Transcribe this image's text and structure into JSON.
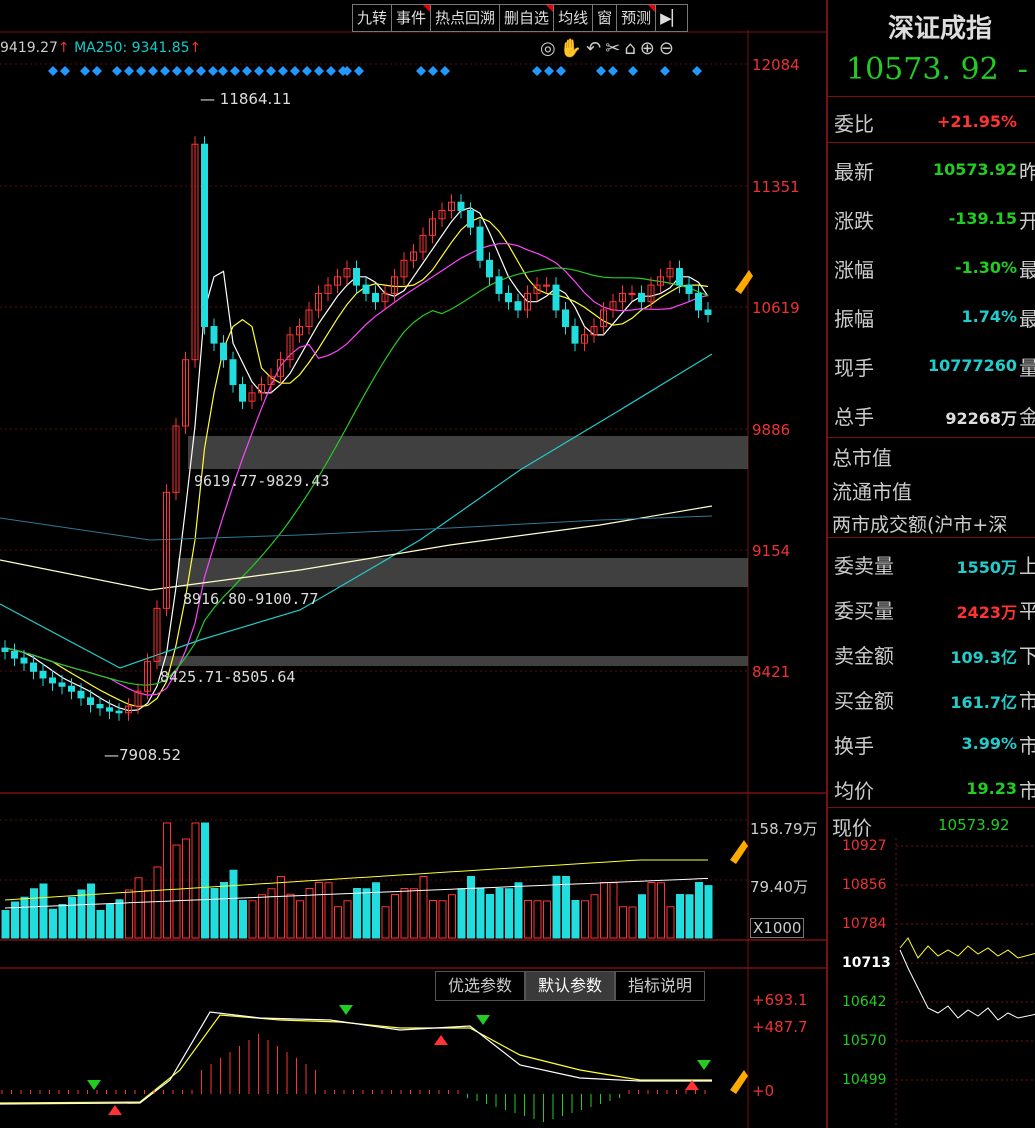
{
  "toolbar": {
    "items": [
      "九转",
      "事件",
      "热点回溯",
      "删自选",
      "均线",
      "窗",
      "预测",
      "▶▏"
    ]
  },
  "ma_row": {
    "ma120": "9419.27",
    "ma120_arrow": "↑",
    "ma250_label": "MA250: 9341.85",
    "ma250_arrow": "↑"
  },
  "main_chart": {
    "price_axis": [
      "12084",
      "11351",
      "10619",
      "9886",
      "9154",
      "8421"
    ],
    "high_label": "11864.11",
    "low_label": "7908.52",
    "zones": [
      {
        "label": "9619.77-9829.43"
      },
      {
        "label": "8916.80-9100.77"
      },
      {
        "label": "8425.71-8505.64"
      }
    ],
    "toolbar_icons": [
      "eye-icon",
      "hand-icon",
      "undo-icon",
      "scissors-icon",
      "lock-icon",
      "zoom-in-icon",
      "zoom-out-icon"
    ]
  },
  "volume_chart": {
    "axis": [
      "158.79万",
      "79.40万",
      "X1000"
    ]
  },
  "indicator": {
    "buttons": [
      "优选参数",
      "默认参数",
      "指标说明"
    ],
    "active": "默认参数",
    "axis": [
      "+693.1",
      "+487.7",
      "+0"
    ]
  },
  "right_panel": {
    "title": "深证成指",
    "price": "10573. 92",
    "price_suffix": "-",
    "rows": [
      {
        "key": "委比",
        "value": "+21.95%",
        "color": "#ff3333",
        "trail": ""
      },
      {
        "key": "最新",
        "value": "10573.92",
        "color": "#22cc22",
        "trail": "昨"
      },
      {
        "key": "涨跌",
        "value": "-139.15",
        "color": "#22cc22",
        "trail": "开"
      },
      {
        "key": "涨幅",
        "value": "-1.30%",
        "color": "#22cc22",
        "trail": "最"
      },
      {
        "key": "振幅",
        "value": "1.74%",
        "color": "#22cccc",
        "trail": "最"
      },
      {
        "key": "现手",
        "value": "10777260",
        "color": "#22cccc",
        "trail": "量"
      },
      {
        "key": "总手",
        "value": "92268万",
        "color": "#dddddd",
        "trail": "金"
      }
    ],
    "market": [
      "总市值",
      "流通市值",
      "两市成交额(沪市+深"
    ],
    "rows2": [
      {
        "key": "委卖量",
        "value": "1550万",
        "color": "#22cccc",
        "trail": "上"
      },
      {
        "key": "委买量",
        "value": "2423万",
        "color": "#ff3333",
        "trail": "平"
      },
      {
        "key": "卖金额",
        "value": "109.3亿",
        "color": "#22cccc",
        "trail": "下"
      },
      {
        "key": "买金额",
        "value": "161.7亿",
        "color": "#22cccc",
        "trail": "市"
      },
      {
        "key": "换手",
        "value": "3.99%",
        "color": "#22cccc",
        "trail": "市"
      },
      {
        "key": "均价",
        "value": "19.23",
        "color": "#22cc22",
        "trail": "市"
      }
    ],
    "mini": {
      "label": "现价",
      "value": "10573.92",
      "axis": [
        "10927",
        "10856",
        "10784",
        "10713",
        "10642",
        "10570",
        "10499"
      ]
    }
  },
  "colors": {
    "up": "#ff3333",
    "down": "#22dddd",
    "grid": "#7a1010",
    "ma5": "#ffffff",
    "ma10": "#ffff33",
    "ma20": "#ff44ff",
    "ma60": "#22cc22",
    "ma120": "#22cccc"
  }
}
